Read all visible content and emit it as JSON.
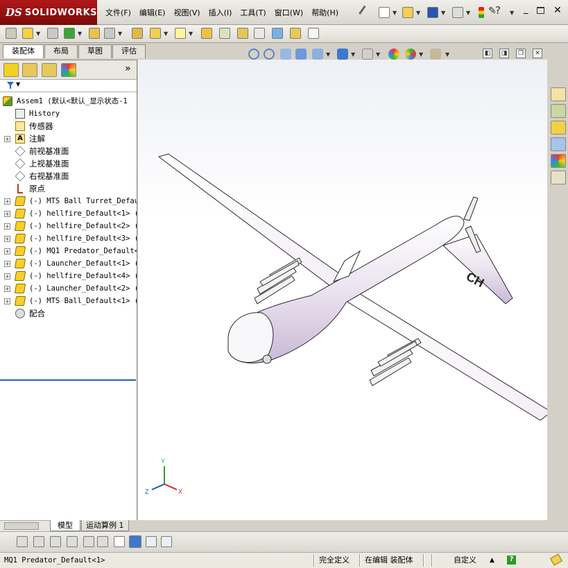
{
  "app": {
    "logo_ds": "DS",
    "logo_brand": "SOLIDWORKS"
  },
  "menu": [
    "文件(F)",
    "编辑(E)",
    "视图(V)",
    "插入(I)",
    "工具(T)",
    "窗口(W)",
    "帮助(H)"
  ],
  "command_manager": {
    "tabs": [
      "装配体",
      "布局",
      "草图",
      "评估"
    ],
    "active": "装配体"
  },
  "feature_manager": {
    "more": "»",
    "tree": [
      {
        "label": "Assem1  (默认<默认_显示状态-1",
        "icon": "assembly-icon",
        "indent": 0,
        "expander": "",
        "cjk": false
      },
      {
        "label": "History",
        "icon": "history-icon",
        "indent": 1,
        "expander": "",
        "cjk": false
      },
      {
        "label": "传感器",
        "icon": "sensor-icon",
        "indent": 1,
        "expander": "",
        "cjk": true
      },
      {
        "label": "注解",
        "icon": "annotation-icon",
        "indent": 1,
        "expander": "+",
        "cjk": true
      },
      {
        "label": "前视基准面",
        "icon": "plane-icon",
        "indent": 1,
        "expander": "",
        "cjk": true
      },
      {
        "label": "上视基准面",
        "icon": "plane-icon",
        "indent": 1,
        "expander": "",
        "cjk": true
      },
      {
        "label": "右视基准面",
        "icon": "plane-icon",
        "indent": 1,
        "expander": "",
        "cjk": true
      },
      {
        "label": "原点",
        "icon": "origin-icon",
        "indent": 1,
        "expander": "",
        "cjk": true
      },
      {
        "label": "(-) MTS Ball Turret_Defaul",
        "icon": "part-icon",
        "indent": 1,
        "expander": "+",
        "cjk": false
      },
      {
        "label": "(-) hellfire_Default<1> (",
        "icon": "part-icon",
        "indent": 1,
        "expander": "+",
        "cjk": false
      },
      {
        "label": "(-) hellfire_Default<2> (",
        "icon": "part-icon",
        "indent": 1,
        "expander": "+",
        "cjk": false
      },
      {
        "label": "(-) hellfire_Default<3> (",
        "icon": "part-icon",
        "indent": 1,
        "expander": "+",
        "cjk": false
      },
      {
        "label": "(-) MQ1 Predator_Default<",
        "icon": "part-icon",
        "indent": 1,
        "expander": "+",
        "cjk": false
      },
      {
        "label": "(-) Launcher_Default<1> (",
        "icon": "part-icon",
        "indent": 1,
        "expander": "+",
        "cjk": false
      },
      {
        "label": "(-) hellfire_Default<4> (",
        "icon": "part-icon",
        "indent": 1,
        "expander": "+",
        "cjk": false
      },
      {
        "label": "(-) Launcher_Default<2> (",
        "icon": "part-icon",
        "indent": 1,
        "expander": "+",
        "cjk": false
      },
      {
        "label": "(-) MTS Ball_Default<1> (",
        "icon": "part-icon",
        "indent": 1,
        "expander": "+",
        "cjk": false
      },
      {
        "label": "配合",
        "icon": "mates-icon",
        "indent": 1,
        "expander": "",
        "cjk": true
      }
    ]
  },
  "model": {
    "tail_marking": "CH",
    "triad": {
      "x": "X",
      "y": "Y",
      "z": "Z"
    }
  },
  "bottom_tabs": [
    "模型",
    "运动算例 1"
  ],
  "status": {
    "selected": "MQ1 Predator_Default<1>",
    "definition": "完全定义",
    "editing": "在编辑 装配体",
    "units": "自定义",
    "units_arrow": "▲",
    "help": "?"
  },
  "colors": {
    "logo_red": "#a51616",
    "tree_separator": "#2a5fb0",
    "viewport_top": "#eef0f6"
  }
}
